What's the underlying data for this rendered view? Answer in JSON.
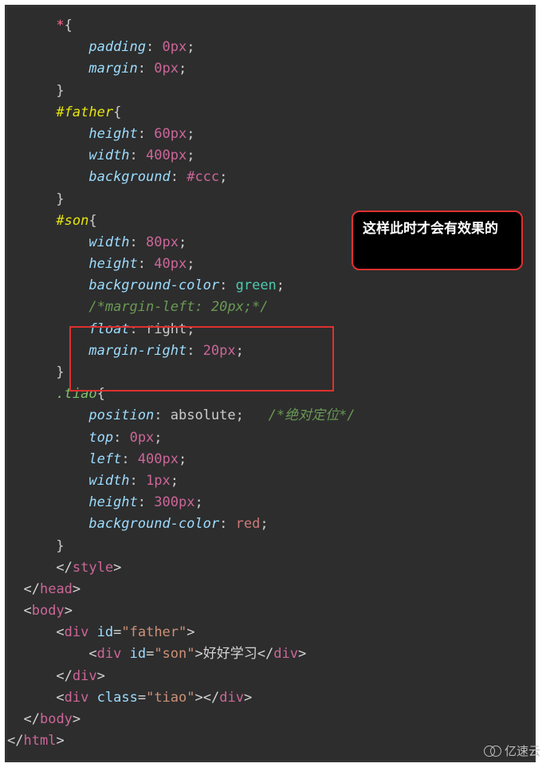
{
  "annotation": "这样此时才会有效果的",
  "watermark": "亿速云",
  "code": {
    "l1a": "*",
    "l1b": "{",
    "l2a": "padding",
    "l2b": "0",
    "l2c": "px",
    "l3a": "margin",
    "l3b": "0",
    "l3c": "px",
    "l4": "}",
    "l5a": "#father",
    "l5b": "{",
    "l6a": "height",
    "l6b": "60",
    "l6c": "px",
    "l7a": "width",
    "l7b": "400",
    "l7c": "px",
    "l8a": "background",
    "l8b": "#ccc",
    "l9": "}",
    "l10a": "#son",
    "l10b": "{",
    "l11a": "width",
    "l11b": "80",
    "l11c": "px",
    "l12a": "height",
    "l12b": "40",
    "l12c": "px",
    "l13a": "background-color",
    "l13b": "green",
    "l14": "/*margin-left: 20px;*/",
    "l15a": "float",
    "l15b": "right",
    "l16a": "margin-right",
    "l16b": "20",
    "l16c": "px",
    "l17": "}",
    "l18a": ".tiao",
    "l18b": "{",
    "l19a": "position",
    "l19b": "absolute",
    "l19c": "/*绝对定位*/",
    "l20a": "top",
    "l20b": "0",
    "l20c": "px",
    "l21a": "left",
    "l21b": "400",
    "l21c": "px",
    "l22a": "width",
    "l22b": "1",
    "l22c": "px",
    "l23a": "height",
    "l23b": "300",
    "l23c": "px",
    "l24a": "background-color",
    "l24b": "red",
    "l25": "}",
    "l26a": "style",
    "l27a": "head",
    "l28a": "body",
    "l29_tag": "div",
    "l29_attr": "id",
    "l29_val": "\"father\"",
    "l30_tag": "div",
    "l30_attr": "id",
    "l30_val": "\"son\"",
    "l30_text": "好好学习",
    "l31_tag": "div",
    "l32_tag": "div",
    "l32_attr": "class",
    "l32_val": "\"tiao\"",
    "l33_tag": "body",
    "l34_tag": "html"
  }
}
